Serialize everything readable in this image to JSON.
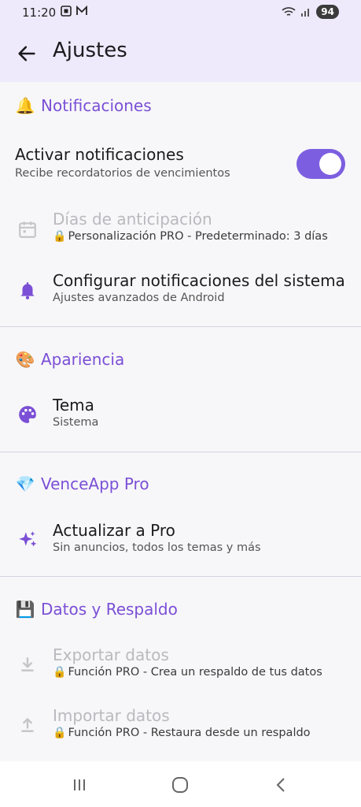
{
  "status_bar": {
    "time": "11:20",
    "battery": "94"
  },
  "app_bar": {
    "title": "Ajustes"
  },
  "sections": {
    "notifications": {
      "emoji": "🔔",
      "title": "Notificaciones",
      "activate": {
        "title": "Activar notificaciones",
        "subtitle": "Recibe recordatorios de vencimientos",
        "enabled": true
      },
      "anticipation": {
        "title": "Días de anticipación",
        "lock": "🔒",
        "subtitle": "Personalización PRO - Predeterminado: 3 días"
      },
      "system": {
        "title": "Configurar notificaciones del sistema",
        "subtitle": "Ajustes avanzados de Android"
      }
    },
    "appearance": {
      "emoji": "🎨",
      "title": "Apariencia",
      "theme": {
        "title": "Tema",
        "subtitle": "Sistema"
      }
    },
    "pro": {
      "emoji": "💎",
      "title": "VenceApp Pro",
      "upgrade": {
        "title": "Actualizar a Pro",
        "subtitle": "Sin anuncios, todos los temas y más"
      }
    },
    "data": {
      "emoji": "💾",
      "title": "Datos y Respaldo",
      "export": {
        "title": "Exportar datos",
        "lock": "🔒",
        "subtitle": "Función PRO - Crea un respaldo de tus datos"
      },
      "import": {
        "title": "Importar datos",
        "lock": "🔒",
        "subtitle": "Función PRO - Restaura desde un respaldo"
      }
    }
  },
  "colors": {
    "accent": "#7b4fd6",
    "appbar": "#efeafb",
    "toggle": "#7c5fe0"
  }
}
